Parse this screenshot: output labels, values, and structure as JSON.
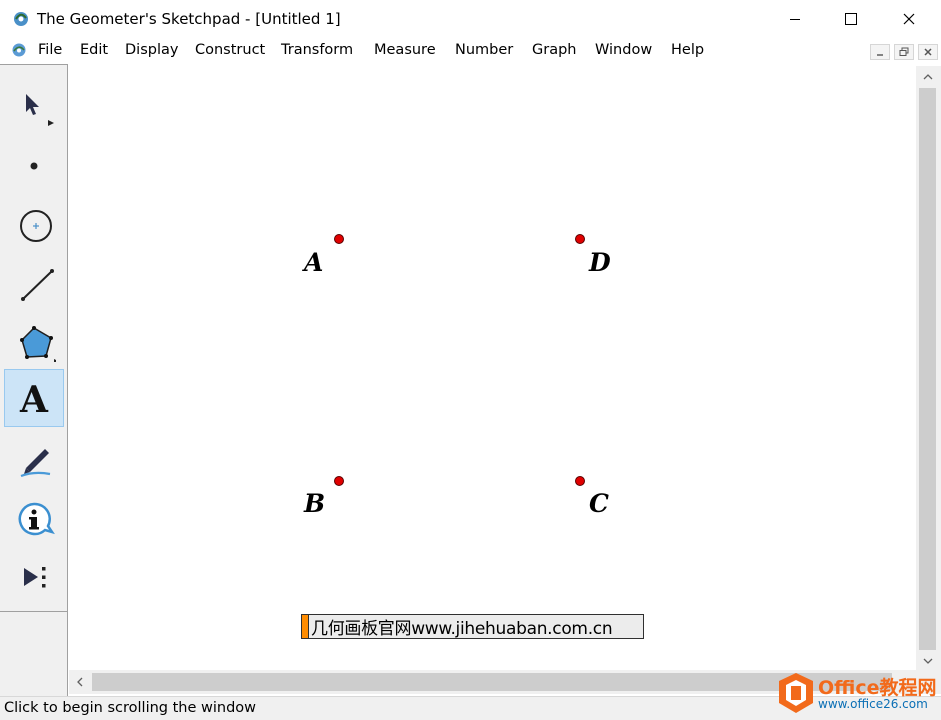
{
  "window": {
    "title": "The Geometer's Sketchpad - [Untitled 1]"
  },
  "menu": {
    "items": [
      "File",
      "Edit",
      "Display",
      "Construct",
      "Transform",
      "Measure",
      "Number",
      "Graph",
      "Window",
      "Help"
    ]
  },
  "toolbox": {
    "tools": [
      {
        "name": "selection-arrow-tool",
        "icon": "arrow-cursor-icon"
      },
      {
        "name": "point-tool",
        "icon": "point-icon"
      },
      {
        "name": "compass-tool",
        "icon": "circle-icon"
      },
      {
        "name": "straightedge-tool",
        "icon": "line-segment-icon"
      },
      {
        "name": "polygon-tool",
        "icon": "pentagon-icon"
      },
      {
        "name": "text-tool",
        "icon": "letter-a-icon",
        "label": "A",
        "selected": true
      },
      {
        "name": "marker-tool",
        "icon": "marker-pen-icon"
      },
      {
        "name": "information-tool",
        "icon": "info-icon"
      },
      {
        "name": "custom-tool",
        "icon": "play-more-icon"
      }
    ]
  },
  "canvas": {
    "points": [
      {
        "label": "A"
      },
      {
        "label": "D"
      },
      {
        "label": "B"
      },
      {
        "label": "C"
      }
    ],
    "caption": "几何画板官网www.jihehuaban.com.cn",
    "point_color": "#e00000"
  },
  "status": {
    "text": "Click to begin scrolling the window"
  },
  "watermark": {
    "title": "Office教程网",
    "url": "www.office26.com",
    "accent": "#f26a1b"
  }
}
